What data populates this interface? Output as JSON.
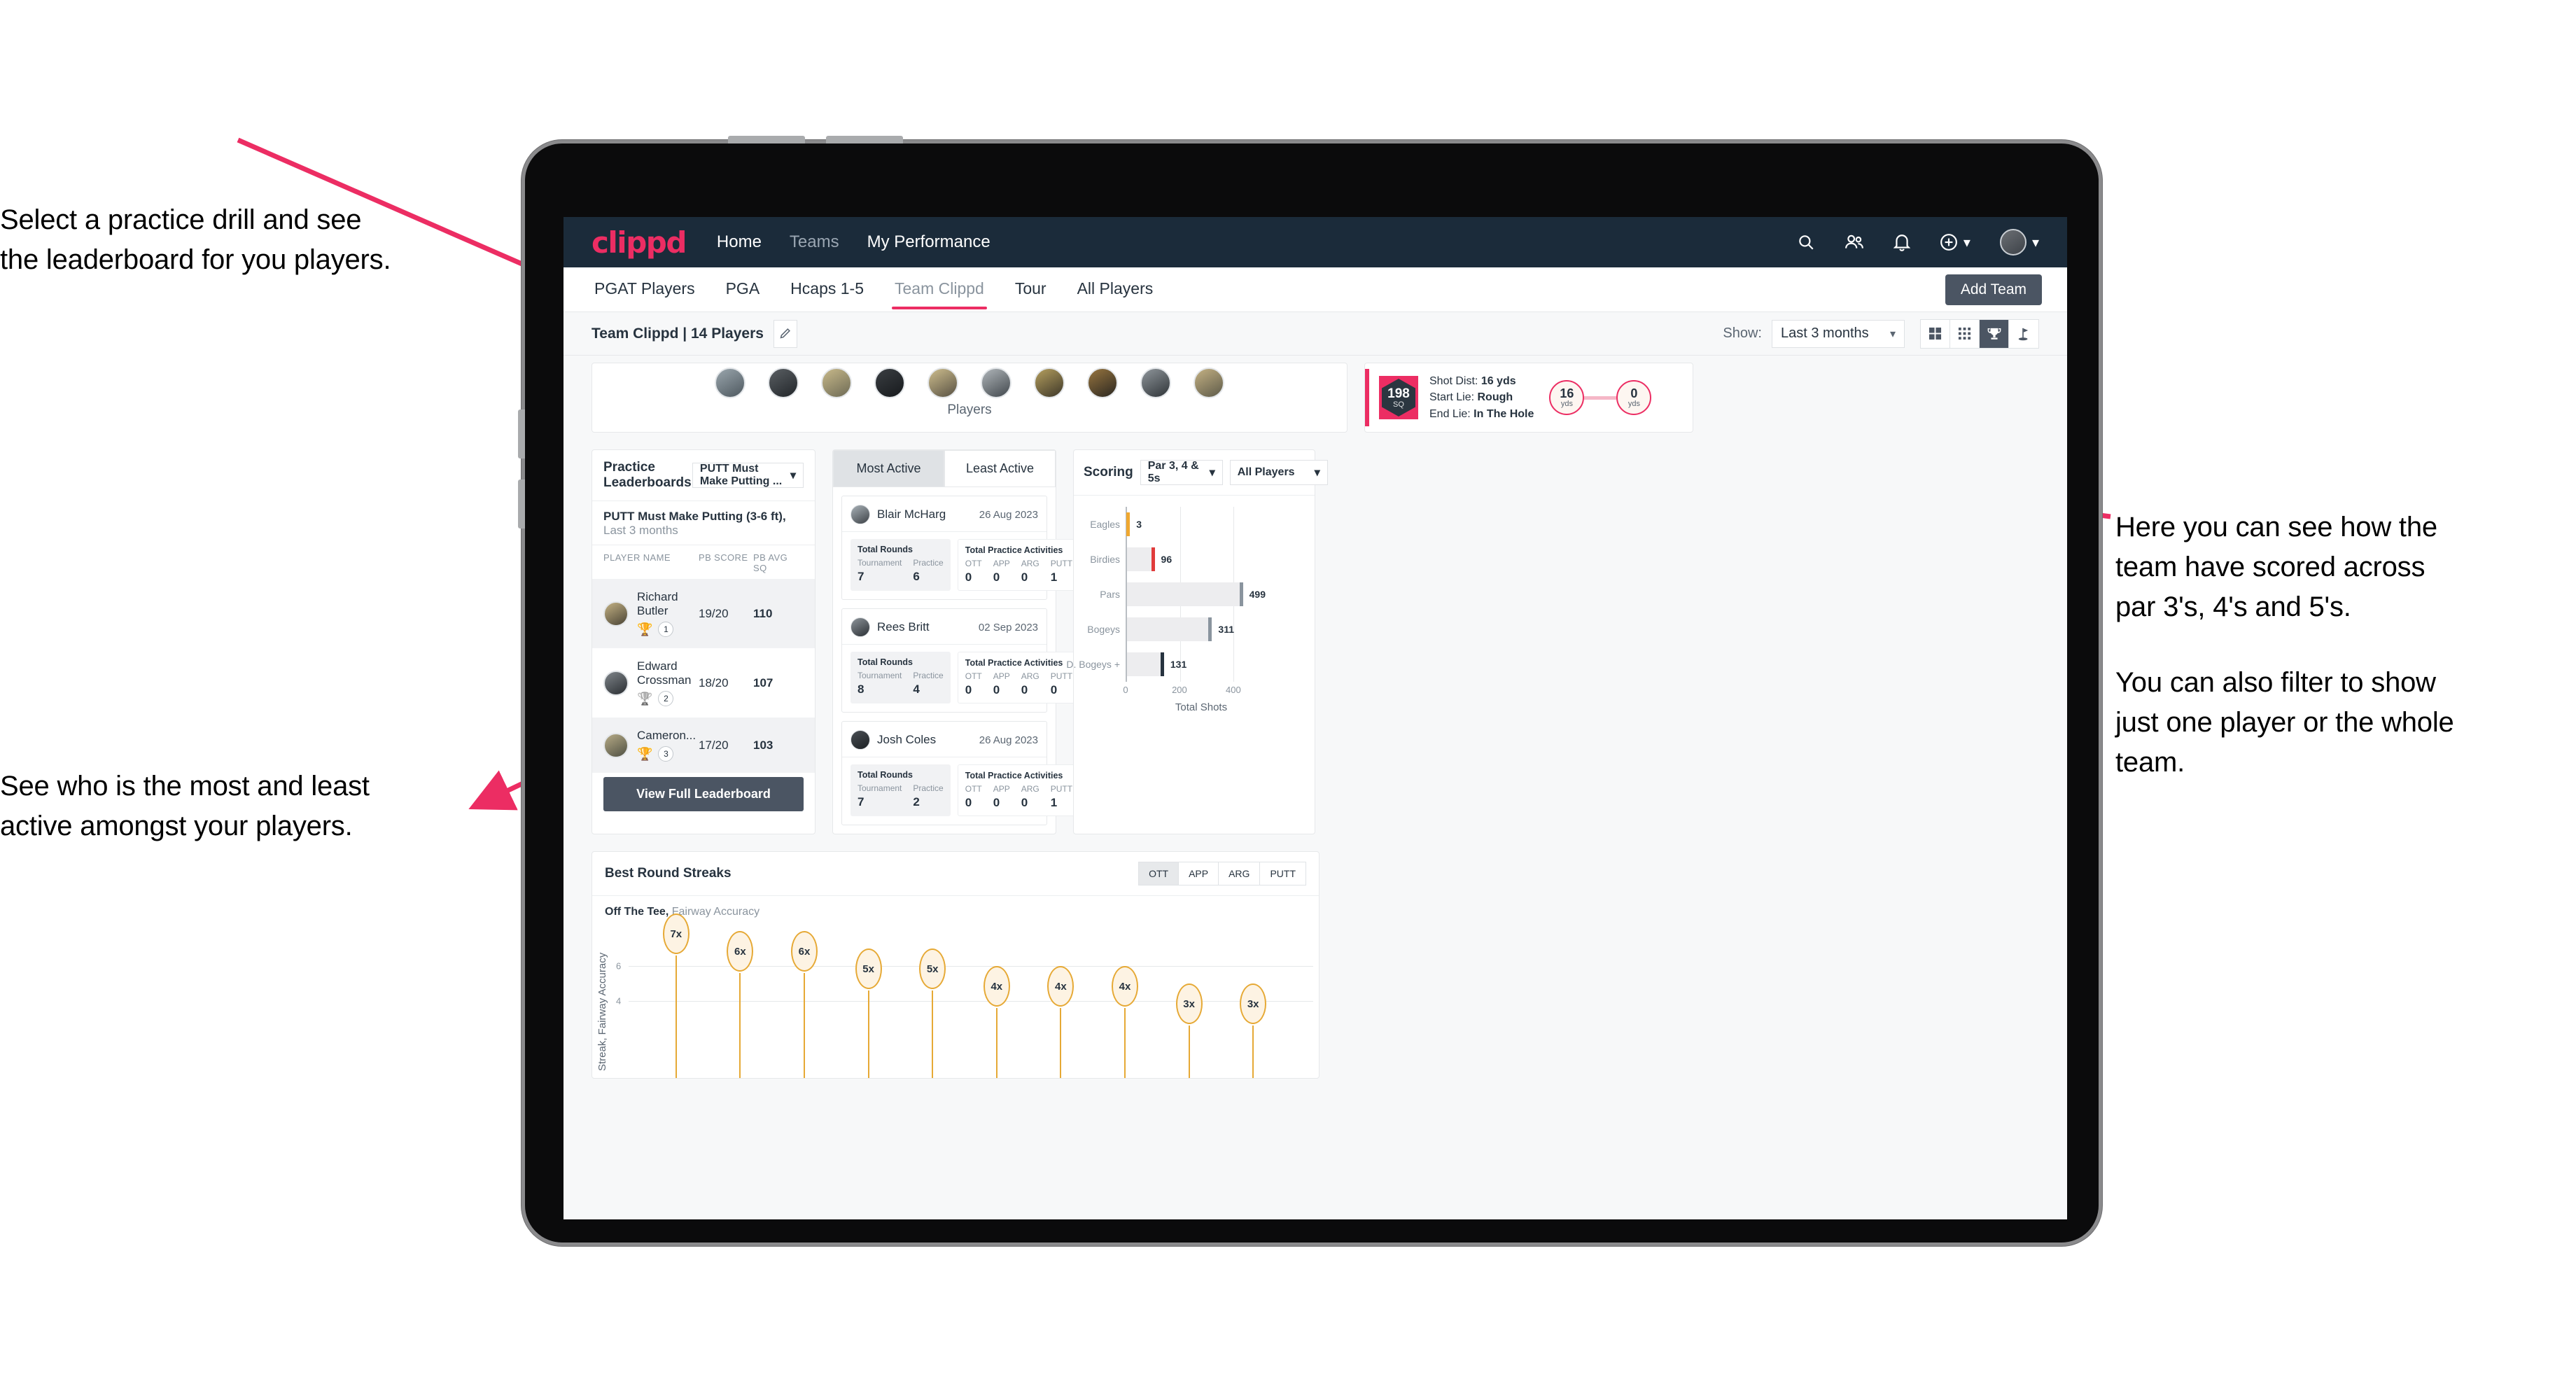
{
  "annotations": {
    "top_left": [
      "Select a practice drill and see",
      "the leaderboard for you players."
    ],
    "bottom_left": [
      "See who is the most and least",
      "active amongst your players."
    ],
    "right_para1": [
      "Here you can see how the",
      "team have scored across",
      "par 3's, 4's and 5's."
    ],
    "right_para2": [
      "You can also filter to show",
      "just one player or the whole",
      "team."
    ]
  },
  "topnav": {
    "logo": "clippd",
    "links": [
      {
        "label": "Home",
        "dim": false
      },
      {
        "label": "Teams",
        "dim": true
      },
      {
        "label": "My Performance",
        "dim": false
      }
    ],
    "icons": [
      "search-icon",
      "people-icon",
      "bell-icon",
      "plus-circle-icon",
      "avatar"
    ]
  },
  "tabbar": {
    "tabs": [
      {
        "label": "PGAT Players",
        "active": false
      },
      {
        "label": "PGA",
        "active": false
      },
      {
        "label": "Hcaps 1-5",
        "active": false
      },
      {
        "label": "Team Clippd",
        "active": true
      },
      {
        "label": "Tour",
        "active": false
      },
      {
        "label": "All Players",
        "active": false
      }
    ],
    "add_team_button": "Add Team"
  },
  "toolbar": {
    "team_label": "Team Clippd | 14 Players",
    "edit_icon": "pencil-icon",
    "show_label": "Show:",
    "show_value": "Last 3 months",
    "view_toggles": [
      {
        "icon": "grid-large-icon",
        "active": false
      },
      {
        "icon": "grid-small-icon",
        "active": false
      },
      {
        "icon": "trophy-icon",
        "active": true
      },
      {
        "icon": "flag-icon",
        "active": false
      }
    ]
  },
  "players_strip": {
    "caption": "Players",
    "avatar_count": 10
  },
  "shot_card": {
    "sq_value": "198",
    "sq_unit": "SQ",
    "lines": [
      {
        "label": "Shot Dist:",
        "value": "16 yds"
      },
      {
        "label": "Start Lie:",
        "value": "Rough"
      },
      {
        "label": "End Lie:",
        "value": "In The Hole"
      }
    ],
    "start_yards": "16",
    "start_unit": "yds",
    "end_yards": "0",
    "end_unit": "yds"
  },
  "leaderboard": {
    "title": "Practice Leaderboards",
    "drill_select": "PUTT Must Make Putting ...",
    "subtitle_bold": "PUTT Must Make Putting (3-6 ft),",
    "subtitle_light": "Last 3 months",
    "columns": [
      "PLAYER NAME",
      "PB SCORE",
      "PB AVG SQ"
    ],
    "rows": [
      {
        "name": "Richard Butler",
        "rank": "1",
        "trophy": "gold",
        "pb_score": "19/20",
        "pb_avg_sq": "110"
      },
      {
        "name": "Edward Crossman",
        "rank": "2",
        "trophy": "silver",
        "pb_score": "18/20",
        "pb_avg_sq": "107"
      },
      {
        "name": "Cameron...",
        "rank": "3",
        "trophy": "bronze",
        "pb_score": "17/20",
        "pb_avg_sq": "103"
      }
    ],
    "full_button": "View Full Leaderboard"
  },
  "activity": {
    "tabs": [
      {
        "label": "Most Active",
        "active": true
      },
      {
        "label": "Least Active",
        "active": false
      }
    ],
    "rounds_title": "Total Rounds",
    "practice_title": "Total Practice Activities",
    "rounds_keys": [
      "Tournament",
      "Practice"
    ],
    "practice_keys": [
      "OTT",
      "APP",
      "ARG",
      "PUTT"
    ],
    "players": [
      {
        "name": "Blair McHarg",
        "date": "26 Aug 2023",
        "tournament": "7",
        "practice": "6",
        "ott": "0",
        "app": "0",
        "arg": "0",
        "putt": "1"
      },
      {
        "name": "Rees Britt",
        "date": "02 Sep 2023",
        "tournament": "8",
        "practice": "4",
        "ott": "0",
        "app": "0",
        "arg": "0",
        "putt": "0"
      },
      {
        "name": "Josh Coles",
        "date": "26 Aug 2023",
        "tournament": "7",
        "practice": "2",
        "ott": "0",
        "app": "0",
        "arg": "0",
        "putt": "1"
      }
    ]
  },
  "scoring": {
    "title": "Scoring",
    "par_select": "Par 3, 4 & 5s",
    "players_select": "All Players"
  },
  "streaks": {
    "title": "Best Round Streaks",
    "segments": [
      {
        "label": "OTT",
        "active": true
      },
      {
        "label": "APP",
        "active": false
      },
      {
        "label": "ARG",
        "active": false
      },
      {
        "label": "PUTT",
        "active": false
      }
    ],
    "sub_bold": "Off The Tee,",
    "sub_light": "Fairway Accuracy"
  },
  "chart_data": [
    {
      "type": "bar",
      "orientation": "horizontal",
      "title": "Scoring",
      "categories": [
        "Eagles",
        "Birdies",
        "Pars",
        "Bogeys",
        "D. Bogeys +"
      ],
      "values": [
        3,
        96,
        499,
        311,
        131
      ],
      "cap_colors": [
        "#f0a830",
        "#e03b3b",
        "#8a949e",
        "#8a949e",
        "#27333f"
      ],
      "xlabel": "Total Shots",
      "ylabel": "",
      "xlim": [
        0,
        520
      ],
      "xticks": [
        0,
        200,
        400
      ],
      "grid": true,
      "legend": "none"
    },
    {
      "type": "bar",
      "orientation": "vertical",
      "title": "Best Round Streaks",
      "subtitle": "Off The Tee, Fairway Accuracy",
      "ylabel": "Streak, Fairway Accuracy",
      "categories": [
        "1",
        "2",
        "3",
        "4",
        "5",
        "6",
        "7",
        "8",
        "9",
        "10"
      ],
      "values": [
        7,
        6,
        6,
        5,
        5,
        4,
        4,
        4,
        3,
        3
      ],
      "labels": [
        "7x",
        "6x",
        "6x",
        "5x",
        "5x",
        "4x",
        "4x",
        "4x",
        "3x",
        "3x"
      ],
      "yticks": [
        4,
        6
      ],
      "ylim": [
        0,
        8
      ],
      "grid": true,
      "legend": "none"
    }
  ]
}
